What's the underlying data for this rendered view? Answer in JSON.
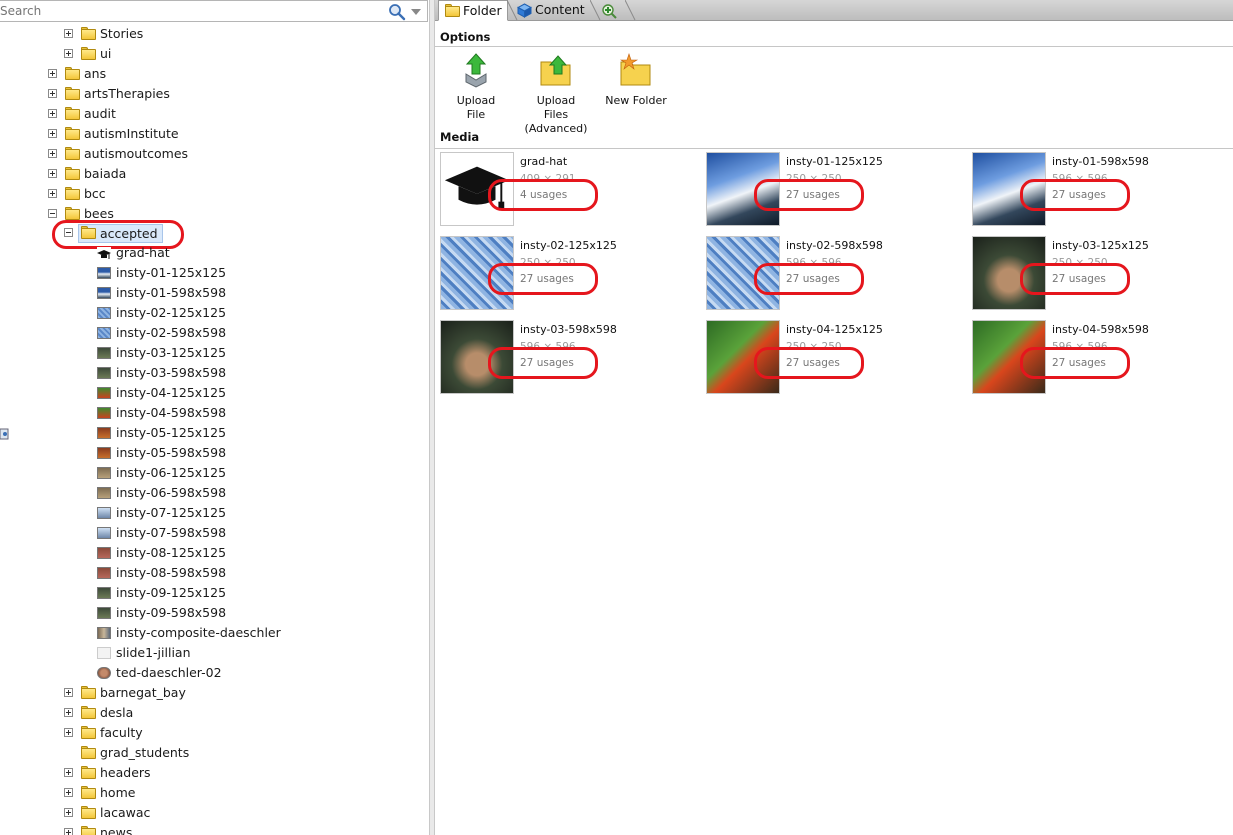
{
  "search": {
    "placeholder": "Search"
  },
  "tree": {
    "stories": "Stories",
    "ui": "ui",
    "ans": "ans",
    "artsTherapies": "artsTherapies",
    "audit": "audit",
    "autismInstitute": "autismInstitute",
    "autismoutcomes": "autismoutcomes",
    "baiada": "baiada",
    "bcc": "bcc",
    "bees": "bees",
    "accepted": "accepted",
    "files": [
      "grad-hat",
      "insty-01-125x125",
      "insty-01-598x598",
      "insty-02-125x125",
      "insty-02-598x598",
      "insty-03-125x125",
      "insty-03-598x598",
      "insty-04-125x125",
      "insty-04-598x598",
      "insty-05-125x125",
      "insty-05-598x598",
      "insty-06-125x125",
      "insty-06-598x598",
      "insty-07-125x125",
      "insty-07-598x598",
      "insty-08-125x125",
      "insty-08-598x598",
      "insty-09-125x125",
      "insty-09-598x598",
      "insty-composite-daeschler",
      "slide1-jillian",
      "ted-daeschler-02"
    ],
    "barnegat_bay": "barnegat_bay",
    "desla": "desla",
    "faculty": "faculty",
    "grad_students": "grad_students",
    "headers": "headers",
    "home": "home",
    "lacawac": "lacawac",
    "news": "news"
  },
  "tabs": {
    "folder": "Folder",
    "content": "Content"
  },
  "options": {
    "heading": "Options",
    "upload_file": "Upload File",
    "upload_files_adv_1": "Upload Files",
    "upload_files_adv_2": "(Advanced)",
    "new_folder": "New Folder"
  },
  "media": {
    "heading": "Media",
    "items": [
      {
        "name": "grad-hat",
        "dims": "409 × 291",
        "usages": "4 usages"
      },
      {
        "name": "insty-01-125x125",
        "dims": "250 × 250",
        "usages": "27 usages"
      },
      {
        "name": "insty-01-598x598",
        "dims": "596 × 596",
        "usages": "27 usages"
      },
      {
        "name": "insty-02-125x125",
        "dims": "250 × 250",
        "usages": "27 usages"
      },
      {
        "name": "insty-02-598x598",
        "dims": "596 × 596",
        "usages": "27 usages"
      },
      {
        "name": "insty-03-125x125",
        "dims": "250 × 250",
        "usages": "27 usages"
      },
      {
        "name": "insty-03-598x598",
        "dims": "596 × 596",
        "usages": "27 usages"
      },
      {
        "name": "insty-04-125x125",
        "dims": "250 × 250",
        "usages": "27 usages"
      },
      {
        "name": "insty-04-598x598",
        "dims": "596 × 596",
        "usages": "27 usages"
      }
    ]
  },
  "colors": {
    "highlight_ring": "#e5161d",
    "selection": "#d9e8fa",
    "folder": "#f3c63a"
  }
}
